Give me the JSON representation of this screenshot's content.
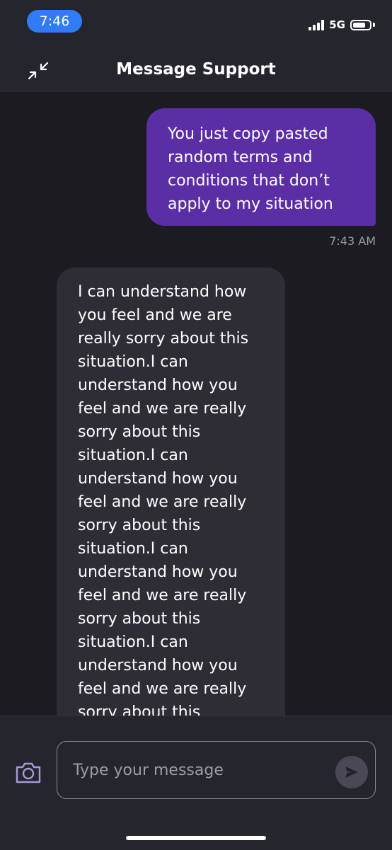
{
  "status_bar": {
    "time": "7:46",
    "network": "5G"
  },
  "header": {
    "title": "Message Support",
    "collapse_icon": "collapse-arrows-icon"
  },
  "messages": [
    {
      "direction": "outgoing",
      "text": "You just copy pasted random terms and conditions that don’t apply to my situation",
      "timestamp": "7:43 AM"
    },
    {
      "direction": "incoming",
      "text": "I can understand how you feel and we are really sorry about this situation.I can understand how you feel and we are really sorry about this situation.I can understand how you feel and we are really sorry about this situation.I can understand how you feel and we are really sorry about this situation.I can understand how you feel and we are really sorry about this"
    }
  ],
  "composer": {
    "placeholder": "Type your message",
    "camera_icon": "camera-icon",
    "send_icon": "send-icon"
  },
  "colors": {
    "background": "#1c1b22",
    "bar": "#25252e",
    "outgoing_bubble": "#5b2ea6",
    "incoming_bubble": "#2e2d35",
    "time_pill": "#2f7cf6"
  }
}
